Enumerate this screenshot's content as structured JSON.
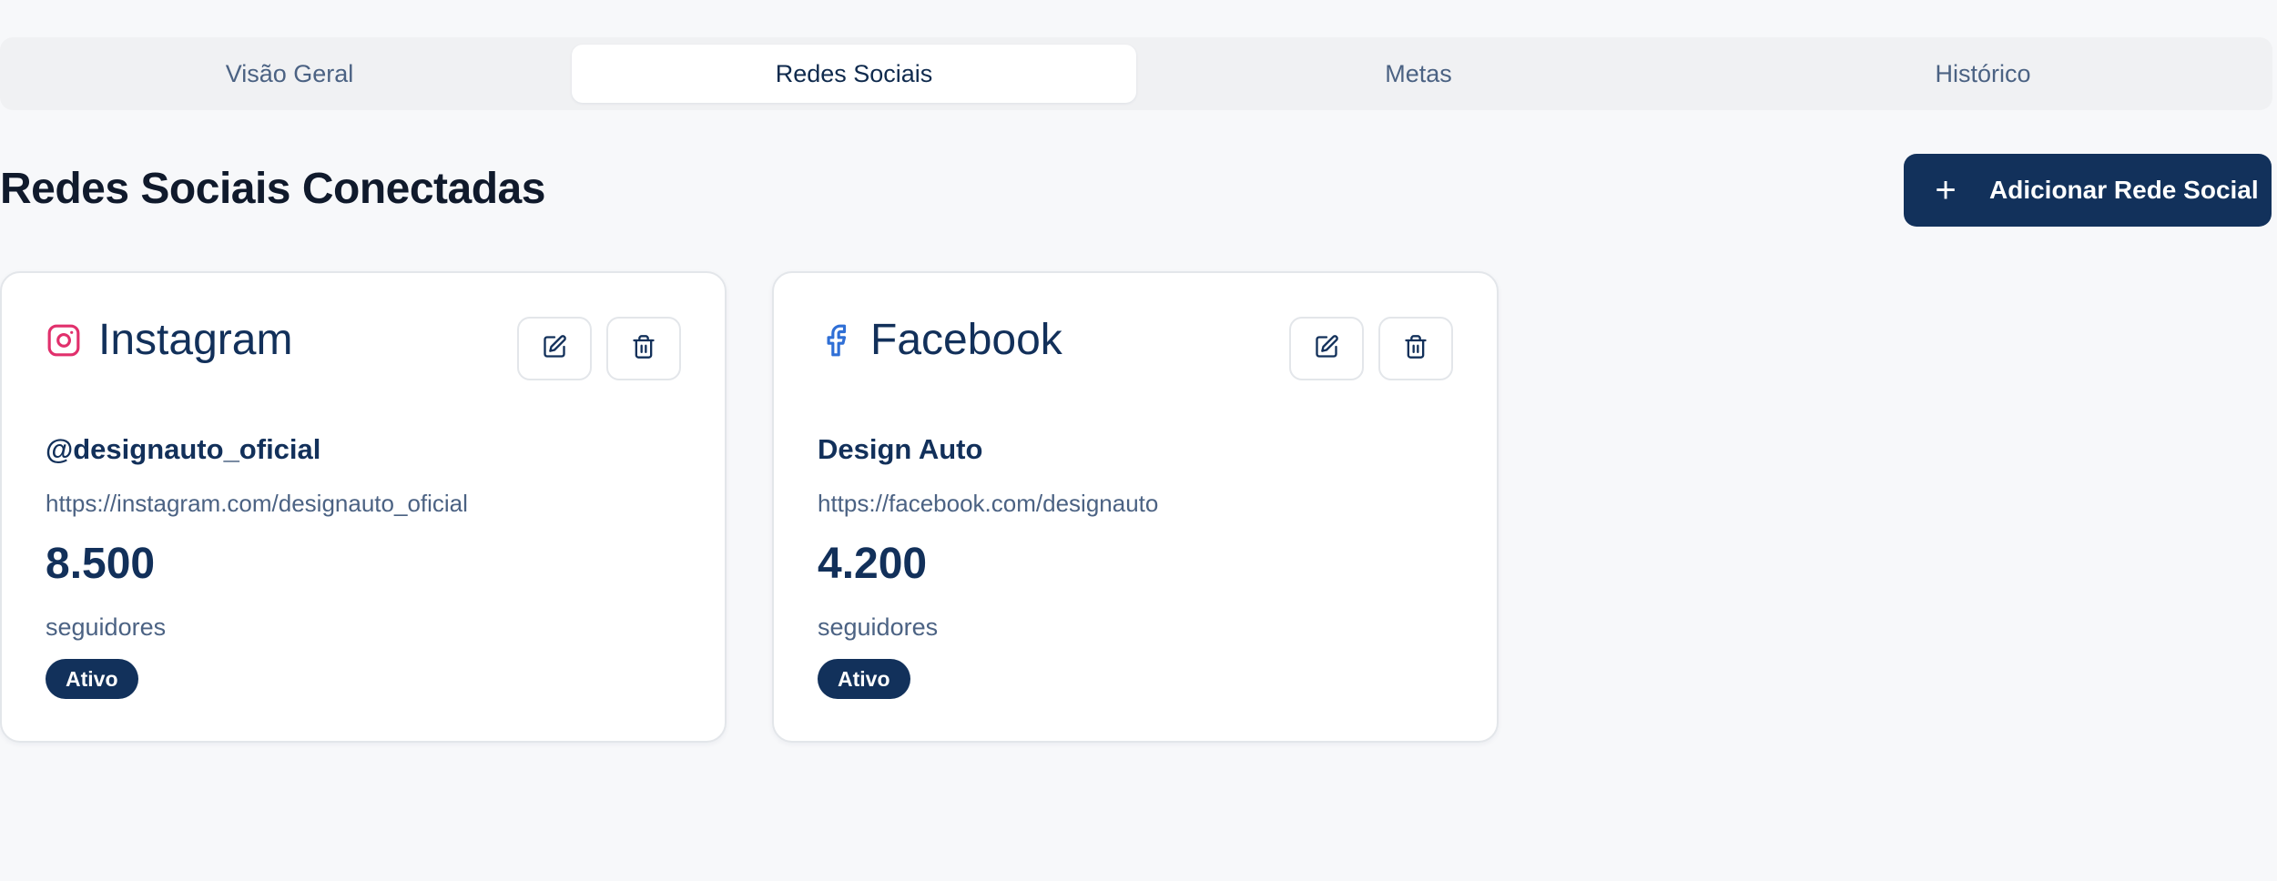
{
  "tabs": [
    {
      "label": "Visão Geral",
      "active": false
    },
    {
      "label": "Redes Sociais",
      "active": true
    },
    {
      "label": "Metas",
      "active": false
    },
    {
      "label": "Histórico",
      "active": false
    }
  ],
  "header": {
    "title": "Redes Sociais Conectadas",
    "add_button_label": "Adicionar Rede Social",
    "add_button_icon": "plus-icon"
  },
  "cards": [
    {
      "network": "Instagram",
      "icon": "instagram-icon",
      "icon_color": "#e1306c",
      "handle": "@designauto_oficial",
      "url": "https://instagram.com/designauto_oficial",
      "followers": "8.500",
      "followers_label": "seguidores",
      "status": "Ativo"
    },
    {
      "network": "Facebook",
      "icon": "facebook-icon",
      "icon_color": "#2f6fd6",
      "handle": "Design Auto",
      "url": "https://facebook.com/designauto",
      "followers": "4.200",
      "followers_label": "seguidores",
      "status": "Ativo"
    }
  ],
  "colors": {
    "background": "#f7f8fa",
    "primary": "#12315b",
    "text_primary": "#12305a",
    "text_secondary": "#4b6283",
    "border": "#e3e6ea"
  }
}
